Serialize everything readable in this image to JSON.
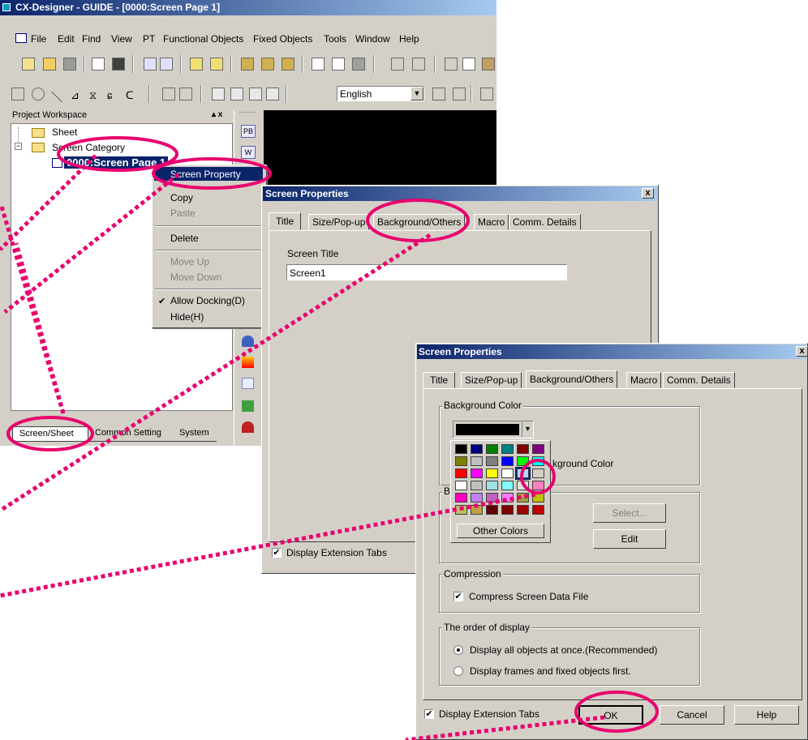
{
  "app": {
    "title": "CX-Designer - GUIDE - [0000:Screen Page 1]",
    "menu": [
      "File",
      "Edit",
      "Find",
      "View",
      "PT",
      "Functional Objects",
      "Fixed Objects",
      "Tools",
      "Window",
      "Help"
    ],
    "language": "English"
  },
  "workspace": {
    "title": "Project Workspace",
    "close": "▴ x",
    "tree": [
      "Sheet",
      "Screen Category",
      "0000:Screen Page 1"
    ],
    "tabs": [
      "Screen/Sheet",
      "Common Setting",
      "System"
    ]
  },
  "palette": {
    "pb": "PB",
    "w": "W"
  },
  "context_menu": {
    "items": [
      "Screen Property",
      "Copy",
      "Paste",
      "Delete",
      "Move Up",
      "Move Down",
      "Allow Docking(D)",
      "Hide(H)"
    ],
    "checked": "✔"
  },
  "dialog1": {
    "title": "Screen Properties",
    "close": "x",
    "tabs": [
      "Title",
      "Size/Pop-up",
      "Background/Others",
      "Macro",
      "Comm. Details"
    ],
    "screen_title_label": "Screen Title",
    "screen_title_value": "Screen1",
    "display_ext_tabs": "Display Extension Tabs",
    "check": "✔"
  },
  "dialog2": {
    "title": "Screen Properties",
    "close": "x",
    "tabs": [
      "Title",
      "Size/Pop-up",
      "Background/Others",
      "Macro",
      "Comm. Details"
    ],
    "bg_color_label": "Background Color",
    "bg_color_partial": "kground Color",
    "b_label": "B",
    "other_colors": "Other Colors",
    "select_button": "Select...",
    "edit_button": "Edit",
    "compression_label": "Compression",
    "compress_check": "Compress Screen Data File",
    "order_label": "The order of display",
    "radio1": "Display all objects at once.(Recommended)",
    "radio2": "Display frames and fixed objects first.",
    "display_ext_tabs": "Display Extension Tabs",
    "ok": "OK",
    "cancel": "Cancel",
    "help": "Help",
    "check": "✔",
    "arrow": "▾",
    "palette_colors": [
      [
        "#000000",
        "#000080",
        "#008000",
        "#008080",
        "#800000",
        "#800080"
      ],
      [
        "#808000",
        "#c0c0c0",
        "#808080",
        "#0000ff",
        "#00ff00",
        "#00ffff"
      ],
      [
        "#ff0000",
        "#ff00ff",
        "#ffff00",
        "#ffffff",
        "#b0d8f8",
        "#d4d0c8"
      ],
      [
        "#ffffff",
        "#c0c0c0",
        "#a0e0e0",
        "#80ffff",
        "#e0e0e0",
        "#ff80c0"
      ],
      [
        "#ff00c0",
        "#c080ff",
        "#c060c0",
        "#ff80ff",
        "#a0a040",
        "#c0c000"
      ],
      [
        "#c0c060",
        "#c0a040",
        "#600000",
        "#800000",
        "#a00000",
        "#c00000"
      ]
    ]
  }
}
